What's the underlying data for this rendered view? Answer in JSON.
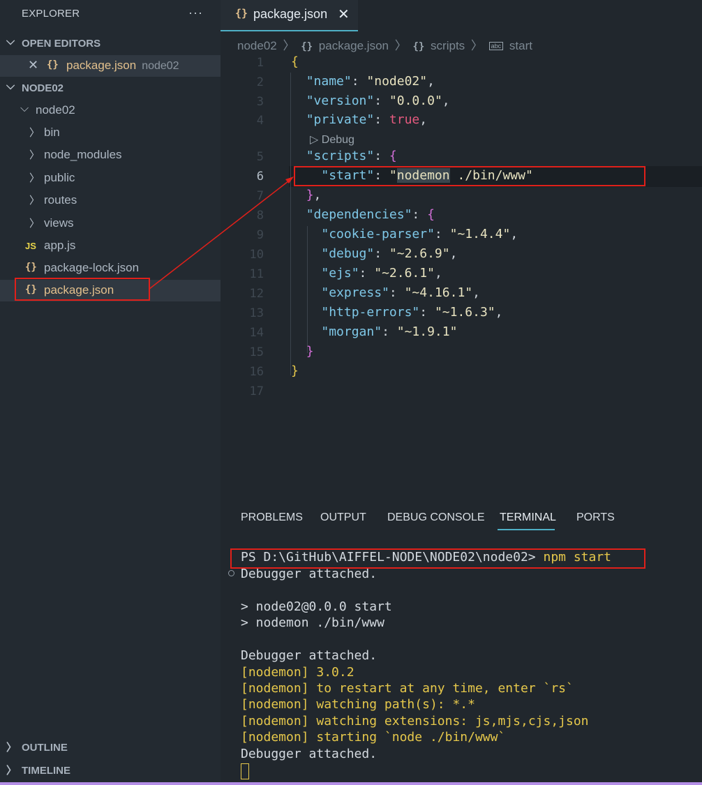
{
  "sidebar": {
    "title": "EXPLORER",
    "more": "···",
    "open_editors": {
      "label": "OPEN EDITORS",
      "item": {
        "name": "package.json",
        "folder": "node02"
      }
    },
    "workspace_label": "NODE02",
    "folder": "node02",
    "tree": [
      {
        "name": "bin",
        "kind": "folder"
      },
      {
        "name": "node_modules",
        "kind": "folder"
      },
      {
        "name": "public",
        "kind": "folder"
      },
      {
        "name": "routes",
        "kind": "folder"
      },
      {
        "name": "views",
        "kind": "folder"
      },
      {
        "name": "app.js",
        "kind": "js"
      },
      {
        "name": "package-lock.json",
        "kind": "json"
      },
      {
        "name": "package.json",
        "kind": "json",
        "selected": true
      }
    ],
    "outline_label": "OUTLINE",
    "timeline_label": "TIMELINE"
  },
  "tab": {
    "label": "package.json",
    "icon": "{}"
  },
  "breadcrumbs": [
    "node02",
    "package.json",
    "scripts",
    "start"
  ],
  "editor": {
    "current_line": 6,
    "codelens": "Debug",
    "lines": [
      "1",
      "2",
      "3",
      "4",
      "5",
      "6",
      "7",
      "8",
      "9",
      "10",
      "11",
      "12",
      "13",
      "14",
      "15",
      "16",
      "17"
    ],
    "code": {
      "name_key": "\"name\"",
      "name_val": "\"node02\"",
      "version_key": "\"version\"",
      "version_val": "\"0.0.0\"",
      "private_key": "\"private\"",
      "private_val": "true",
      "scripts_key": "\"scripts\"",
      "start_key": "\"start\"",
      "start_q": "\"",
      "start_cmd": "nodemon",
      "start_rest": " ./bin/www\"",
      "deps_key": "\"dependencies\"",
      "deps": [
        {
          "k": "\"cookie-parser\"",
          "v": "\"~1.4.4\""
        },
        {
          "k": "\"debug\"",
          "v": "\"~2.6.9\""
        },
        {
          "k": "\"ejs\"",
          "v": "\"~2.6.1\""
        },
        {
          "k": "\"express\"",
          "v": "\"~4.16.1\""
        },
        {
          "k": "\"http-errors\"",
          "v": "\"~1.6.3\""
        },
        {
          "k": "\"morgan\"",
          "v": "\"~1.9.1\""
        }
      ]
    }
  },
  "panel": {
    "tabs": [
      "PROBLEMS",
      "OUTPUT",
      "DEBUG CONSOLE",
      "TERMINAL",
      "PORTS"
    ],
    "active_tab": "TERMINAL"
  },
  "terminal": {
    "prompt": "PS D:\\GitHub\\AIFFEL-NODE\\NODE02\\node02> ",
    "command": "npm start",
    "lines": [
      "Debugger attached.",
      "",
      "> node02@0.0.0 start",
      "> nodemon ./bin/www",
      "",
      "Debugger attached."
    ],
    "nodemon_tag": "[nodemon]",
    "nodemon_lines": [
      " 3.0.2",
      " to restart at any time, enter `rs`",
      " watching path(s): *.*",
      " watching extensions: js,mjs,cjs,json",
      " starting `node ./bin/www`"
    ],
    "last_line": "Debugger attached."
  },
  "colors": {
    "accent": "#4fb0c6",
    "annotation": "#e0201a",
    "status_bar": "#b48ee6"
  }
}
